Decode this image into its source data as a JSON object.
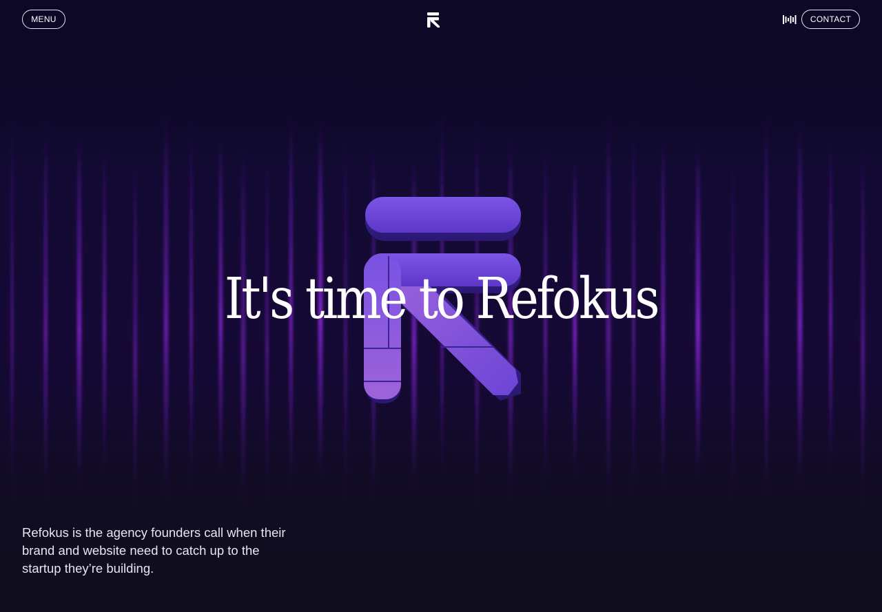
{
  "header": {
    "menu_label": "MENU",
    "contact_label": "CONTACT",
    "logo_icon": "refokus-logo-icon",
    "sound_icon": "sound-wave-icon"
  },
  "hero": {
    "headline": "It's time to Refokus",
    "emblem_icon": "refokus-r-emblem-icon"
  },
  "intro": {
    "text": "Refokus is the agency founders call when their brand and website need to catch up to the startup they’re building."
  },
  "colors": {
    "background": "#0e0a24",
    "stripe": "#8a1fd6",
    "emblem": "#6f47d9",
    "text": "#ffffff"
  }
}
